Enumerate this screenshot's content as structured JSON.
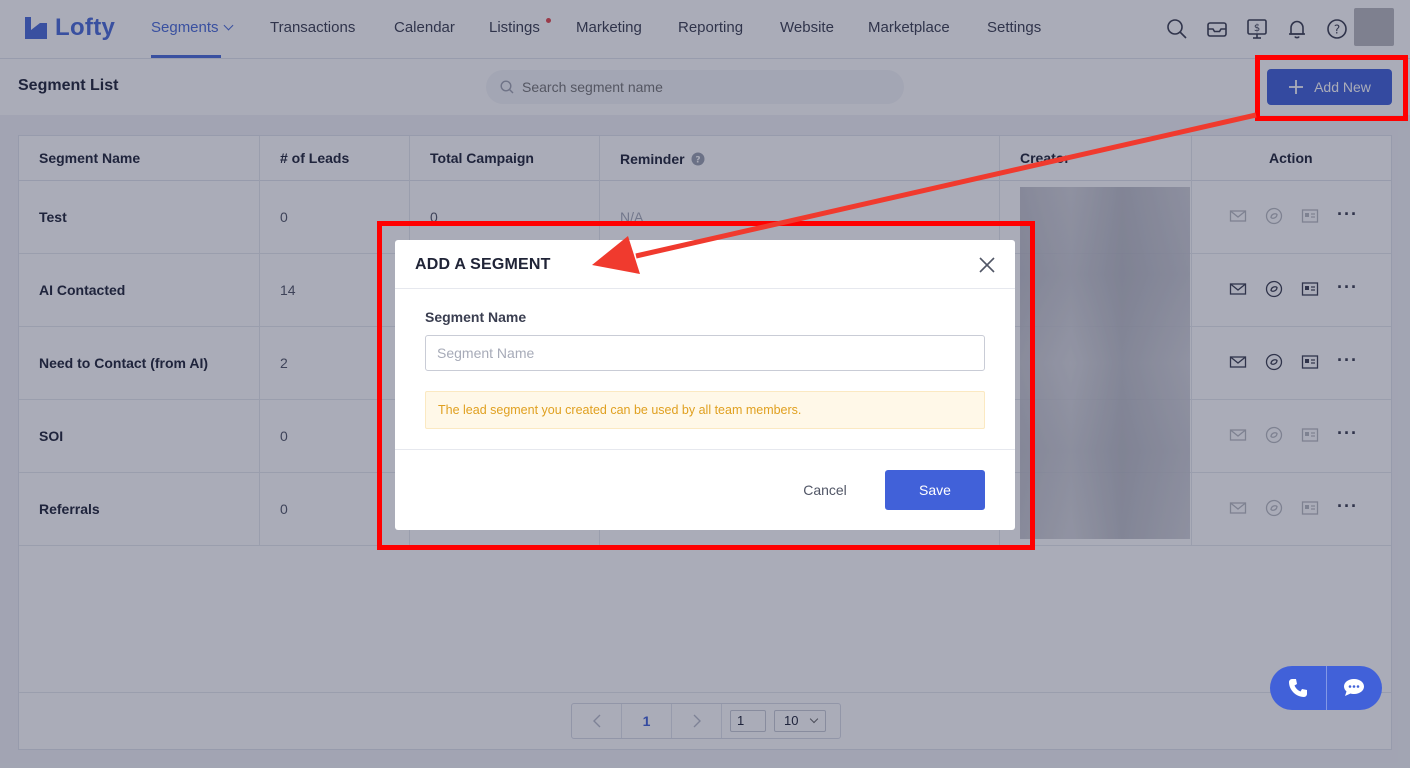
{
  "brand": {
    "name": "Lofty",
    "accent": "#4161d9",
    "highlight": "#ff0000"
  },
  "nav": {
    "items": [
      {
        "label": "Segments",
        "active": true
      },
      {
        "label": "Transactions"
      },
      {
        "label": "Calendar"
      },
      {
        "label": "Listings",
        "has_dot": true
      },
      {
        "label": "Marketing"
      },
      {
        "label": "Reporting"
      },
      {
        "label": "Website"
      },
      {
        "label": "Marketplace"
      },
      {
        "label": "Settings"
      }
    ],
    "icons": [
      "search-icon",
      "inbox-icon",
      "dollar-screen-icon",
      "bell-icon",
      "help-icon"
    ]
  },
  "subheader": {
    "title": "Segment List",
    "search_placeholder": "Search segment name",
    "add_label": "Add New"
  },
  "table": {
    "columns": [
      "Segment Name",
      "# of Leads",
      "Total Campaign",
      "Reminder",
      "Creator",
      "Action"
    ],
    "rows": [
      {
        "name": "Test",
        "leads": "0",
        "campaign": "0",
        "reminder": "N/A",
        "actions_enabled": false
      },
      {
        "name": "AI Contacted",
        "leads": "14",
        "campaign": "",
        "reminder": "",
        "actions_enabled": true
      },
      {
        "name": "Need to Contact (from AI)",
        "leads": "2",
        "campaign": "",
        "reminder": "",
        "actions_enabled": true
      },
      {
        "name": "SOI",
        "leads": "0",
        "campaign": "",
        "reminder": "",
        "actions_enabled": false
      },
      {
        "name": "Referrals",
        "leads": "0",
        "campaign": "",
        "reminder": "",
        "actions_enabled": false
      }
    ]
  },
  "pagination": {
    "current": "1",
    "page_input": "1",
    "page_size": "10"
  },
  "modal": {
    "title": "ADD A SEGMENT",
    "field_label": "Segment Name",
    "field_placeholder": "Segment Name",
    "field_value": "",
    "notice": "The lead segment you created can be used by all team members.",
    "cancel_label": "Cancel",
    "save_label": "Save"
  }
}
